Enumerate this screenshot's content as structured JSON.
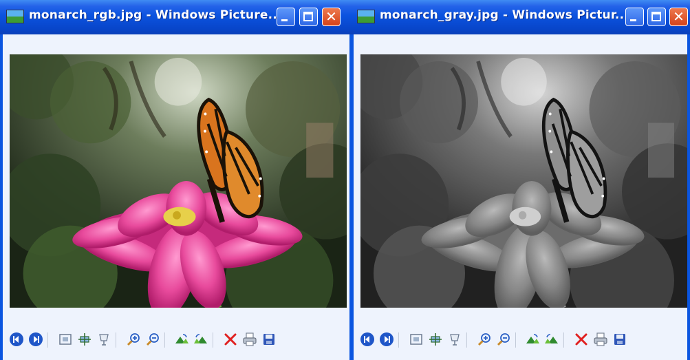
{
  "windows": [
    {
      "title": "monarch_rgb.jpg - Windows Picture...",
      "image": {
        "kind": "color"
      }
    },
    {
      "title": "monarch_gray.jpg - Windows Pictur...",
      "image": {
        "kind": "grayscale"
      }
    }
  ],
  "toolbar_icons": [
    "previous-image-icon",
    "next-image-icon",
    "best-fit-icon",
    "actual-size-icon",
    "slide-show-icon",
    "zoom-in-icon",
    "zoom-out-icon",
    "rotate-clockwise-icon",
    "rotate-counterclockwise-icon",
    "delete-icon",
    "print-icon",
    "save-icon"
  ],
  "colors": {
    "titlebar": "#0b53df",
    "client_background": "#eef3fd",
    "close_button": "#d4421a",
    "nav_button": "#1f56c8"
  }
}
